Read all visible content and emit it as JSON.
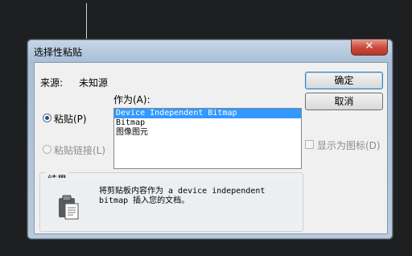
{
  "dialog": {
    "title": "选择性粘贴",
    "close_label": "✕",
    "source_label": "来源:",
    "source_value": "未知源",
    "as_label": "作为(A):",
    "ok_label": "确定",
    "cancel_label": "取消",
    "paste_label": "粘贴(P)",
    "paste_link_label": "粘贴链接(L)",
    "display_as_icon_label": "显示为图标(D)",
    "result_title": "结果",
    "result_text": "将剪贴板内容作为 a device independent bitmap 插入您的文档。",
    "formats": [
      "Device Independent Bitmap",
      "Bitmap",
      "图像图元"
    ],
    "selected_format": "Device Independent Bitmap",
    "paste_checked": true,
    "paste_link_enabled": false,
    "display_as_icon_checked": false
  }
}
